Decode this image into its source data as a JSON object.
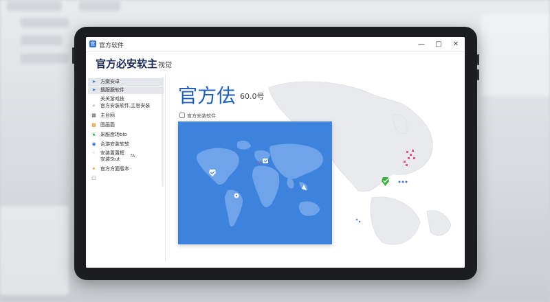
{
  "window": {
    "icon_glyph": "官",
    "title": "官方软件",
    "controls": {
      "minimize": "—",
      "maximize": "□",
      "close": "✕"
    }
  },
  "header": {
    "title": "官方必安软主",
    "title_suffix": "视觉"
  },
  "sidebar": {
    "items": [
      {
        "icon": "arrow-up-icon",
        "label": "方案安卓",
        "extra": ""
      },
      {
        "icon": "arrow-up-icon",
        "label": "搜服服软件",
        "extra": ""
      },
      {
        "icon": "",
        "label": "关关游戏技",
        "extra": ""
      },
      {
        "icon": "search-icon",
        "label": "官方安装软件,主官安装",
        "extra": ""
      },
      {
        "icon": "grid-icon",
        "label": "主台网",
        "extra": ""
      },
      {
        "icon": "colorful-grid-icon",
        "label": "图画面",
        "extra": ""
      },
      {
        "icon": "leaf-icon",
        "label": "采服度场bio",
        "extra": ""
      },
      {
        "icon": "shield-icon",
        "label": "合游安装软软",
        "extra": ""
      },
      {
        "icon": "dots-icon",
        "label": "安装置置框",
        "label2": "安装Stut",
        "extra": "fA"
      },
      {
        "icon": "star-icon",
        "label": "官方方面版本",
        "extra": ""
      },
      {
        "icon": "square-icon",
        "label": "",
        "extra": ""
      }
    ]
  },
  "main": {
    "title": "官方佉",
    "subtitle": "60.0号",
    "card_label": "官方安装软件"
  },
  "colors": {
    "accent": "#1f5fb8",
    "map_blue": "#3d83de",
    "marker_green": "#3cb043",
    "pink_cluster": "#e8547a"
  }
}
